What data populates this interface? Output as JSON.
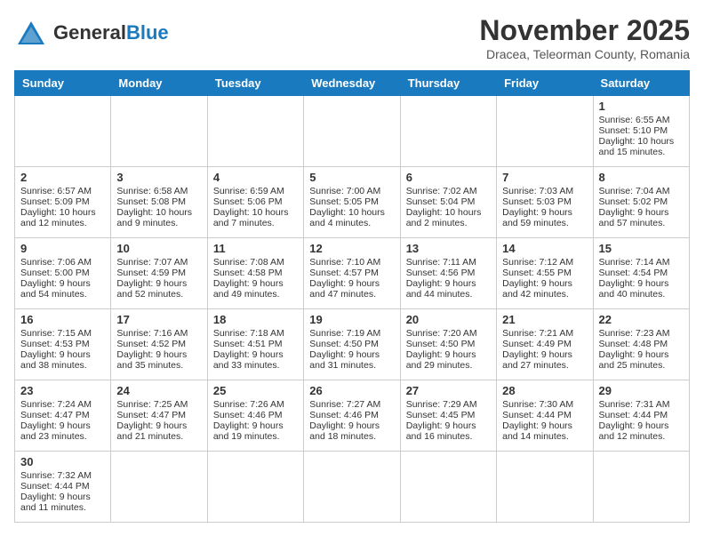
{
  "header": {
    "logo_general": "General",
    "logo_blue": "Blue",
    "month_title": "November 2025",
    "subtitle": "Dracea, Teleorman County, Romania"
  },
  "days_of_week": [
    "Sunday",
    "Monday",
    "Tuesday",
    "Wednesday",
    "Thursday",
    "Friday",
    "Saturday"
  ],
  "weeks": [
    [
      {
        "day": "",
        "content": ""
      },
      {
        "day": "",
        "content": ""
      },
      {
        "day": "",
        "content": ""
      },
      {
        "day": "",
        "content": ""
      },
      {
        "day": "",
        "content": ""
      },
      {
        "day": "",
        "content": ""
      },
      {
        "day": "1",
        "content": "Sunrise: 6:55 AM\nSunset: 5:10 PM\nDaylight: 10 hours\nand 15 minutes."
      }
    ],
    [
      {
        "day": "2",
        "content": "Sunrise: 6:57 AM\nSunset: 5:09 PM\nDaylight: 10 hours\nand 12 minutes."
      },
      {
        "day": "3",
        "content": "Sunrise: 6:58 AM\nSunset: 5:08 PM\nDaylight: 10 hours\nand 9 minutes."
      },
      {
        "day": "4",
        "content": "Sunrise: 6:59 AM\nSunset: 5:06 PM\nDaylight: 10 hours\nand 7 minutes."
      },
      {
        "day": "5",
        "content": "Sunrise: 7:00 AM\nSunset: 5:05 PM\nDaylight: 10 hours\nand 4 minutes."
      },
      {
        "day": "6",
        "content": "Sunrise: 7:02 AM\nSunset: 5:04 PM\nDaylight: 10 hours\nand 2 minutes."
      },
      {
        "day": "7",
        "content": "Sunrise: 7:03 AM\nSunset: 5:03 PM\nDaylight: 9 hours\nand 59 minutes."
      },
      {
        "day": "8",
        "content": "Sunrise: 7:04 AM\nSunset: 5:02 PM\nDaylight: 9 hours\nand 57 minutes."
      }
    ],
    [
      {
        "day": "9",
        "content": "Sunrise: 7:06 AM\nSunset: 5:00 PM\nDaylight: 9 hours\nand 54 minutes."
      },
      {
        "day": "10",
        "content": "Sunrise: 7:07 AM\nSunset: 4:59 PM\nDaylight: 9 hours\nand 52 minutes."
      },
      {
        "day": "11",
        "content": "Sunrise: 7:08 AM\nSunset: 4:58 PM\nDaylight: 9 hours\nand 49 minutes."
      },
      {
        "day": "12",
        "content": "Sunrise: 7:10 AM\nSunset: 4:57 PM\nDaylight: 9 hours\nand 47 minutes."
      },
      {
        "day": "13",
        "content": "Sunrise: 7:11 AM\nSunset: 4:56 PM\nDaylight: 9 hours\nand 44 minutes."
      },
      {
        "day": "14",
        "content": "Sunrise: 7:12 AM\nSunset: 4:55 PM\nDaylight: 9 hours\nand 42 minutes."
      },
      {
        "day": "15",
        "content": "Sunrise: 7:14 AM\nSunset: 4:54 PM\nDaylight: 9 hours\nand 40 minutes."
      }
    ],
    [
      {
        "day": "16",
        "content": "Sunrise: 7:15 AM\nSunset: 4:53 PM\nDaylight: 9 hours\nand 38 minutes."
      },
      {
        "day": "17",
        "content": "Sunrise: 7:16 AM\nSunset: 4:52 PM\nDaylight: 9 hours\nand 35 minutes."
      },
      {
        "day": "18",
        "content": "Sunrise: 7:18 AM\nSunset: 4:51 PM\nDaylight: 9 hours\nand 33 minutes."
      },
      {
        "day": "19",
        "content": "Sunrise: 7:19 AM\nSunset: 4:50 PM\nDaylight: 9 hours\nand 31 minutes."
      },
      {
        "day": "20",
        "content": "Sunrise: 7:20 AM\nSunset: 4:50 PM\nDaylight: 9 hours\nand 29 minutes."
      },
      {
        "day": "21",
        "content": "Sunrise: 7:21 AM\nSunset: 4:49 PM\nDaylight: 9 hours\nand 27 minutes."
      },
      {
        "day": "22",
        "content": "Sunrise: 7:23 AM\nSunset: 4:48 PM\nDaylight: 9 hours\nand 25 minutes."
      }
    ],
    [
      {
        "day": "23",
        "content": "Sunrise: 7:24 AM\nSunset: 4:47 PM\nDaylight: 9 hours\nand 23 minutes."
      },
      {
        "day": "24",
        "content": "Sunrise: 7:25 AM\nSunset: 4:47 PM\nDaylight: 9 hours\nand 21 minutes."
      },
      {
        "day": "25",
        "content": "Sunrise: 7:26 AM\nSunset: 4:46 PM\nDaylight: 9 hours\nand 19 minutes."
      },
      {
        "day": "26",
        "content": "Sunrise: 7:27 AM\nSunset: 4:46 PM\nDaylight: 9 hours\nand 18 minutes."
      },
      {
        "day": "27",
        "content": "Sunrise: 7:29 AM\nSunset: 4:45 PM\nDaylight: 9 hours\nand 16 minutes."
      },
      {
        "day": "28",
        "content": "Sunrise: 7:30 AM\nSunset: 4:44 PM\nDaylight: 9 hours\nand 14 minutes."
      },
      {
        "day": "29",
        "content": "Sunrise: 7:31 AM\nSunset: 4:44 PM\nDaylight: 9 hours\nand 12 minutes."
      }
    ],
    [
      {
        "day": "30",
        "content": "Sunrise: 7:32 AM\nSunset: 4:44 PM\nDaylight: 9 hours\nand 11 minutes."
      },
      {
        "day": "",
        "content": ""
      },
      {
        "day": "",
        "content": ""
      },
      {
        "day": "",
        "content": ""
      },
      {
        "day": "",
        "content": ""
      },
      {
        "day": "",
        "content": ""
      },
      {
        "day": "",
        "content": ""
      }
    ]
  ]
}
